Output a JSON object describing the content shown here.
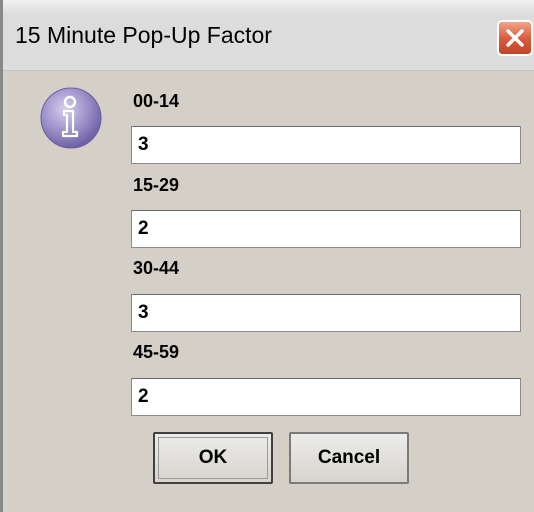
{
  "window": {
    "title": "15 Minute Pop-Up Factor"
  },
  "fields": [
    {
      "label": "00-14",
      "value": "3"
    },
    {
      "label": "15-29",
      "value": "2"
    },
    {
      "label": "30-44",
      "value": "3"
    },
    {
      "label": "45-59",
      "value": "2"
    }
  ],
  "buttons": {
    "ok_label": "OK",
    "cancel_label": "Cancel"
  },
  "icons": {
    "dialog_icon": "info-icon",
    "close_icon": "close-icon"
  },
  "colors": {
    "dialog_bg": "#d4d0c8",
    "close_button": "#d8583a",
    "icon_purple": "#8a7db8"
  }
}
